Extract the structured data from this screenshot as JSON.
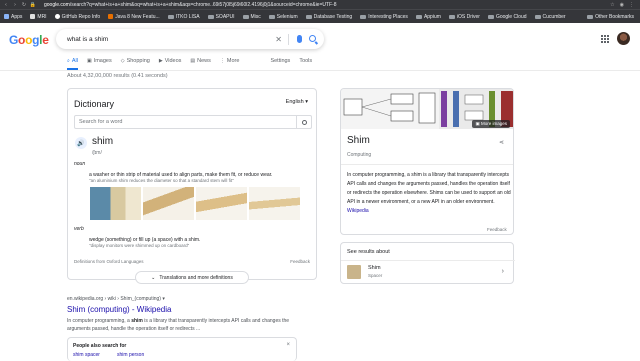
{
  "browser": {
    "url_prefix": "google.com",
    "url_rest": "/search?q=what+is+a+shim&oq=what+is+a+shim&aqs=chrome..69i57j0l5j69i60l2.4196j0j1&sourceid=chrome&ie=UTF-8",
    "bookmarks": [
      "Apps",
      "MRI",
      "GitHub Repo Info",
      "Java 8 New Featu...",
      "ITKO LISA",
      "SOAPUI",
      "Misc",
      "Selenium",
      "Database Testing",
      "Interesting Places",
      "Appium",
      "iOS Driver",
      "Google Cloud",
      "Cucumber"
    ],
    "other_bookmarks": "Other Bookmarks"
  },
  "search": {
    "logo": [
      "G",
      "o",
      "o",
      "g",
      "l",
      "e"
    ],
    "query": "what is a shim"
  },
  "tabs": [
    {
      "label": "All",
      "icon": "search-icon"
    },
    {
      "label": "Images",
      "icon": "image-icon"
    },
    {
      "label": "Shopping",
      "icon": "tag-icon"
    },
    {
      "label": "Videos",
      "icon": "play-icon"
    },
    {
      "label": "News",
      "icon": "news-icon"
    },
    {
      "label": "More",
      "icon": "more-vert-icon"
    },
    {
      "label": "Settings"
    },
    {
      "label": "Tools"
    }
  ],
  "stats": "About 4,32,00,000 results (0.41 seconds)",
  "dictionary": {
    "title": "Dictionary",
    "language": "English",
    "search_placeholder": "Search for a word",
    "word": "shim",
    "phonetic": "/ʃɪm/",
    "pos_noun": "noun",
    "noun_def": "a washer or thin strip of material used to align parts, make them fit, or reduce wear.",
    "noun_example": "\"an aluminium shim reduces the diameter so that a standard stem will fit\"",
    "pos_verb": "verb",
    "verb_def": "wedge (something) or fill up (a space) with a shim.",
    "verb_example": "\"display monitors were shimmed up on cardboard\"",
    "source": "Definitions from Oxford Languages",
    "feedback": "Feedback",
    "translations": "Translations and more definitions"
  },
  "result": {
    "cite": "en.wikipedia.org › wiki › Shim_(computing)",
    "title": "Shim (computing) - Wikipedia",
    "snippet_1": "In computer programming, a ",
    "snippet_bold": "shim",
    "snippet_2": " is a library that transparently intercepts API calls and changes the arguments passed, handle the operation itself or redirects ..."
  },
  "people_also_search": {
    "heading": "People also search for",
    "links": [
      "shim spacer",
      "shim person"
    ]
  },
  "knowledge_panel": {
    "more_images": "More images",
    "title": "Shim",
    "subtitle": "Computing",
    "description": "In computer programming, a shim is a library that transparently intercepts API calls and changes the arguments passed, handles the operation itself or redirects the operation elsewhere. Shims can be used to support an old API in a newer environment, or a new API in an older environment.",
    "link": "Wikipedia",
    "feedback": "Feedback"
  },
  "see_results_about": {
    "heading": "See results about",
    "item_name": "Shim",
    "item_sub": "Spacer"
  }
}
